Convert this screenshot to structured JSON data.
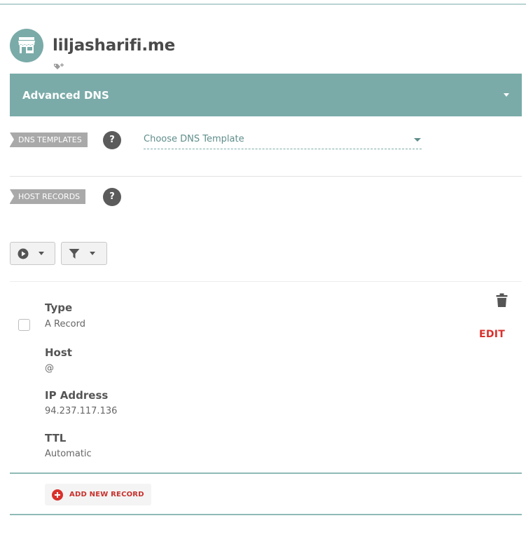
{
  "domain": {
    "name": "liljasharifi.me",
    "avatar_icon": "storefront-icon",
    "tag_icon": "tag-add-icon"
  },
  "section": {
    "title": "Advanced DNS",
    "caret_icon": "caret-down-icon"
  },
  "dns_templates": {
    "label": "DNS TEMPLATES",
    "help": "?",
    "select_placeholder": "Choose DNS Template"
  },
  "host_records": {
    "label": "HOST RECORDS",
    "help": "?",
    "toolbar": {
      "actions_icon": "play-circle-icon",
      "filter_icon": "filter-icon"
    }
  },
  "record": {
    "fields": [
      {
        "label": "Type",
        "value": "A Record"
      },
      {
        "label": "Host",
        "value": "@"
      },
      {
        "label": "IP Address",
        "value": "94.237.117.136"
      },
      {
        "label": "TTL",
        "value": "Automatic"
      }
    ],
    "edit_label": "EDIT",
    "delete_icon": "trash-icon"
  },
  "add_record": {
    "label": "ADD NEW RECORD",
    "icon": "plus-circle-icon"
  },
  "colors": {
    "accent_teal": "#7aaba8",
    "action_red": "#d9302c",
    "tag_gray": "#a9a9a9"
  }
}
